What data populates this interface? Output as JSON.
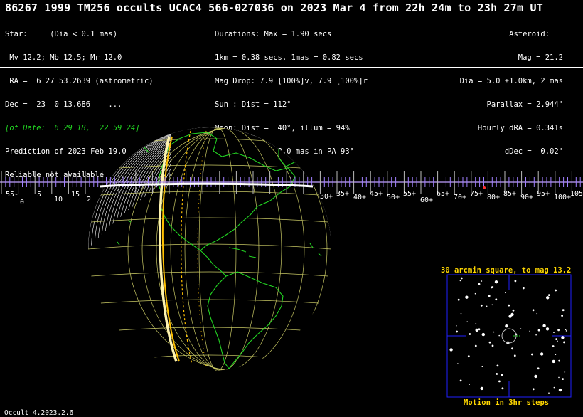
{
  "title": "86267 1999 TM256 occults UCAC4 566-027036 on 2023 Mar  4 from 22h 24m to 23h 27m UT",
  "star_info": [
    "Star:     (Dia < 0.1 mas)",
    " Mv 12.2; Mb 12.5; Mr 12.0",
    " RA =  6 27 53.2639 (astrometric)",
    "Dec =  23  0 13.686    ...",
    "[of Date:  6 29 18,  22 59 24]",
    "Prediction of 2023 Feb 19.0",
    "Reliable not available"
  ],
  "event_info": [
    "Durations: Max = 1.90 secs",
    "1km = 0.38 secs, 1mas = 0.82 secs",
    "Mag Drop: 7.9 [100%]v, 7.9 [100%]r",
    "Sun : Dist = 112°",
    "Moon: Dist =  40°, illum = 94%",
    "Error 23.0 x 18.0 mas in PA 93°"
  ],
  "asteroid_info": [
    "Asteroid:   ",
    "Mag = 21.2",
    "Dia = 5.0 ±1.0km, 2 mas",
    "Parallax = 2.944\"",
    "Hourly dRA = 0.341s",
    "dDec =  0.02\""
  ],
  "scale": {
    "left_labels": [
      "55-",
      "0",
      "5",
      "10",
      "15",
      "2"
    ],
    "right_labels": [
      "30+",
      "35+",
      "40+",
      "45+",
      "50+",
      "55+",
      "60+",
      "65+",
      "70+",
      "75+",
      "80+",
      "85+",
      "90+",
      "95+",
      "100+",
      "105"
    ]
  },
  "inset": {
    "title": "30 arcmin square, to mag 13.2",
    "footer": "Motion in 3hr steps"
  },
  "footer": "Occult 4.2023.2.6",
  "colors": {
    "background": "#000000",
    "coastline": "#22d422",
    "grid": "#c8c864",
    "path": "#ffc000",
    "inset_text": "#ffd700",
    "inset_frame": "#2020ff",
    "scale": "#c0a0ff"
  }
}
